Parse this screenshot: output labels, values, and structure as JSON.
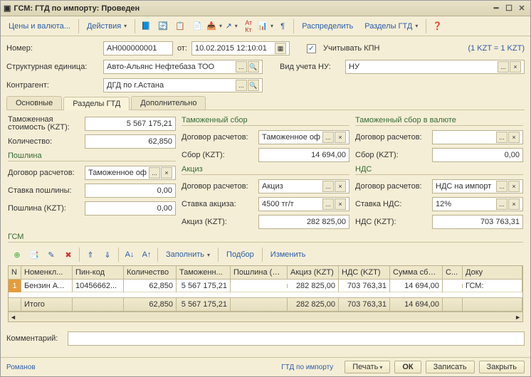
{
  "window": {
    "title": "ГСМ: ГТД по импорту: Проведен"
  },
  "toolbar": {
    "prices": "Цены и валюта...",
    "actions": "Действия",
    "distribute": "Распределить",
    "sections": "Разделы ГТД"
  },
  "header": {
    "number_label": "Номер:",
    "number_value": "АН000000001",
    "from_label": "от:",
    "date_value": "10.02.2015 12:10:01",
    "kpn_label": "Учитывать КПН",
    "rate_note": "(1 KZT = 1 KZT)",
    "unit_label": "Структурная единица:",
    "unit_value": "Авто-Альянс Нефтебаза ТОО",
    "view_label": "Вид учета НУ:",
    "view_value": "НУ",
    "contragent_label": "Контрагент:",
    "contragent_value": "ДГД по г.Астана"
  },
  "tabs": {
    "main": "Основные",
    "sections": "Разделы ГТД",
    "extra": "Дополнительно"
  },
  "col1_head": "",
  "col2_head": "Таможенный сбор",
  "col3_head": "Таможенный сбор в валюте",
  "col1": {
    "cost_label": "Таможенная стоимость (KZT):",
    "cost_value": "5 567 175,21",
    "qty_label": "Количество:",
    "qty_value": "62,850",
    "duty_head": "Пошлина",
    "contract_label": "Договор расчетов:",
    "contract_value": "Таможенное оф",
    "rate_label": "Ставка пошлины:",
    "rate_value": "0,00",
    "duty_label": "Пошлина (KZT):",
    "duty_value": "0,00"
  },
  "col2": {
    "contract_label": "Договор расчетов:",
    "contract_value": "Таможенное оф",
    "fee_label": "Сбор (KZT):",
    "fee_value": "14 694,00",
    "excise_head": "Акциз",
    "e_contract_label": "Договор расчетов:",
    "e_contract_value": "Акциз",
    "e_rate_label": "Ставка акциза:",
    "e_rate_value": "4500 тг/т",
    "excise_label": "Акциз (KZT):",
    "excise_value": "282 825,00"
  },
  "col3": {
    "contract_label": "Договор расчетов:",
    "contract_value": "",
    "fee_label": "Сбор (KZT):",
    "fee_value": "0,00",
    "vat_head": "НДС",
    "v_contract_label": "Договор расчетов:",
    "v_contract_value": "НДС на импорт",
    "v_rate_label": "Ставка НДС:",
    "v_rate_value": "12%",
    "vat_label": "НДС (KZT):",
    "vat_value": "703 763,31"
  },
  "grid": {
    "title": "ГСМ",
    "toolbar": {
      "fill": "Заполнить",
      "pick": "Подбор",
      "edit": "Изменить"
    },
    "cols": [
      "N",
      "Номенкл...",
      "Пин-код",
      "Количество",
      "Таможенн...",
      "Пошлина (KZT)",
      "Акциз (KZT)",
      "НДС (KZT)",
      "Сумма сбора",
      "С...",
      "Доку"
    ],
    "row": {
      "n": "1",
      "name": "Бензин А...",
      "pin": "10456662...",
      "qty": "62,850",
      "cost": "5 567 175,21",
      "duty": "",
      "excise": "282 825,00",
      "vat": "703 763,31",
      "fee": "14 694,00",
      "s": "",
      "doc": "ГСМ:"
    },
    "total_label": "Итого",
    "totals": {
      "qty": "62,850",
      "cost": "5 567 175,21",
      "duty": "",
      "excise": "282 825,00",
      "vat": "703 763,31",
      "fee": "14 694,00"
    }
  },
  "comment_label": "Комментарий:",
  "status": {
    "user": "Романов",
    "mode": "ГТД по импорту"
  },
  "buttons": {
    "print": "Печать",
    "ok": "ОК",
    "save": "Записать",
    "close": "Закрыть"
  }
}
